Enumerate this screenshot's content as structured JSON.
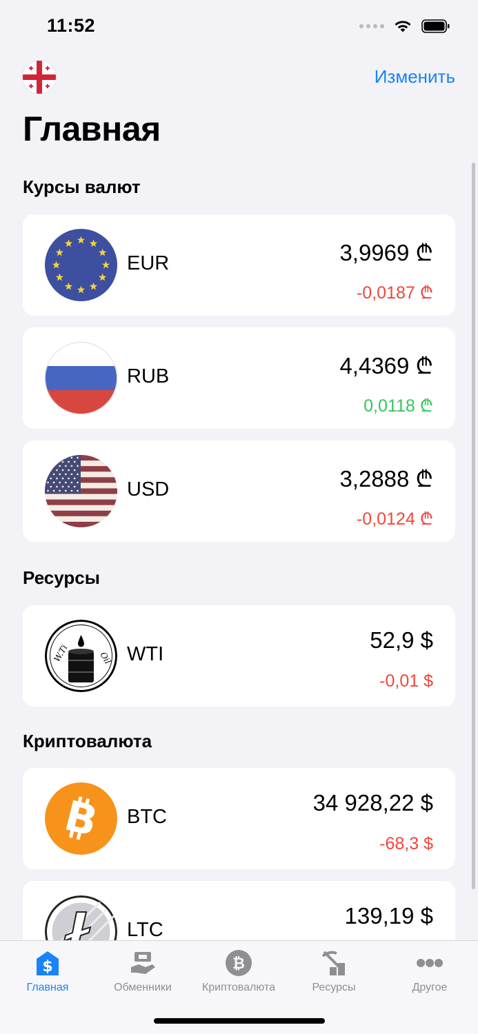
{
  "status_bar": {
    "time": "11:52"
  },
  "header": {
    "edit_label": "Изменить",
    "title": "Главная"
  },
  "sections": {
    "currencies": "Курсы валют",
    "resources": "Ресурсы",
    "crypto": "Криптовалюта"
  },
  "currencies": [
    {
      "code": "EUR",
      "price": "3,9969 ₾",
      "change": "-0,0187 ₾",
      "direction": "down"
    },
    {
      "code": "RUB",
      "price": "4,4369 ₾",
      "change": "0,0118 ₾",
      "direction": "up"
    },
    {
      "code": "USD",
      "price": "3,2888 ₾",
      "change": "-0,0124 ₾",
      "direction": "down"
    }
  ],
  "resources": [
    {
      "code": "WTI",
      "price": "52,9 $",
      "change": "-0,01 $",
      "direction": "down",
      "logo_text": "WTI Oil"
    }
  ],
  "crypto": [
    {
      "code": "BTC",
      "price": "34 928,22 $",
      "change": "-68,3 $",
      "direction": "down"
    },
    {
      "code": "LTC",
      "price": "139,19 $",
      "change": "",
      "direction": ""
    }
  ],
  "tabs": [
    {
      "label": "Главная",
      "icon": "home-dollar-icon",
      "active": true
    },
    {
      "label": "Обменники",
      "icon": "exchange-icon",
      "active": false
    },
    {
      "label": "Криптовалюта",
      "icon": "bitcoin-icon",
      "active": false
    },
    {
      "label": "Ресурсы",
      "icon": "resources-icon",
      "active": false
    },
    {
      "label": "Другое",
      "icon": "more-icon",
      "active": false
    }
  ],
  "colors": {
    "accent": "#1a82fb",
    "negative": "#f4443a",
    "positive": "#34c759",
    "background": "#f2f2f7"
  }
}
